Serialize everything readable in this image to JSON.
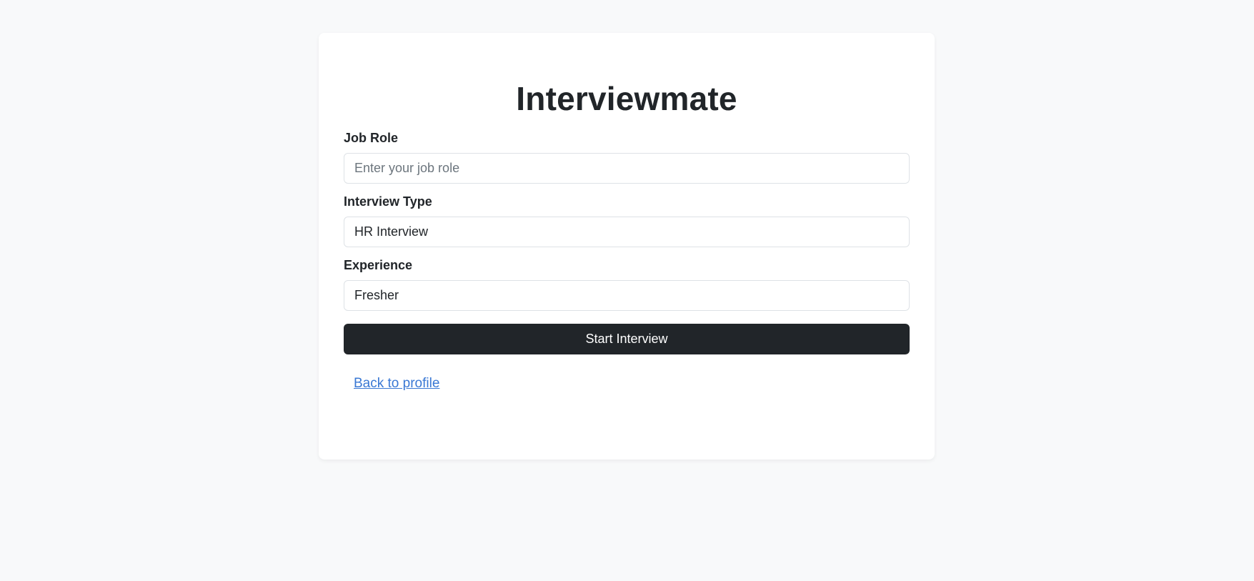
{
  "app": {
    "title": "Interviewmate"
  },
  "form": {
    "job_role": {
      "label": "Job Role",
      "value": "",
      "placeholder": "Enter your job role"
    },
    "interview_type": {
      "label": "Interview Type",
      "selected": "HR Interview"
    },
    "experience": {
      "label": "Experience",
      "selected": "Fresher"
    },
    "submit_label": "Start Interview"
  },
  "links": {
    "back_label": "Back to profile"
  },
  "colors": {
    "page_background": "#f8f9fa",
    "card_background": "#ffffff",
    "primary_button": "#212529",
    "link": "#3a78d4"
  }
}
